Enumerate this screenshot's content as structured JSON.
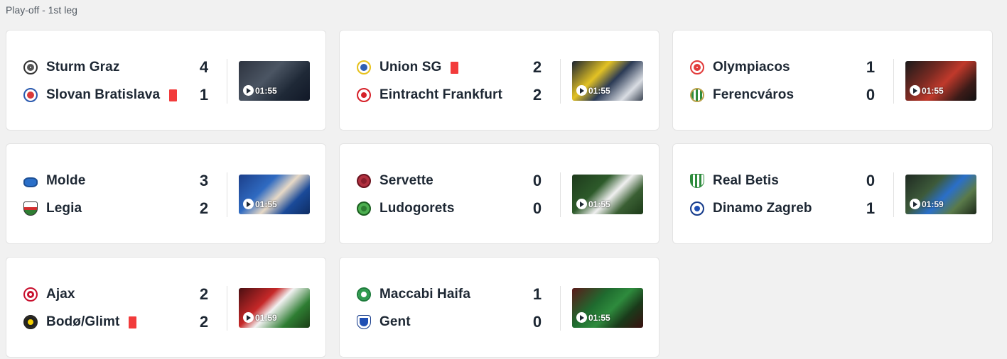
{
  "section_title": "Play-off - 1st leg",
  "matches": [
    {
      "home": {
        "name": "Sturm Graz",
        "score": "4",
        "crest": "sturm-graz-crest",
        "red_card": false
      },
      "away": {
        "name": "Slovan Bratislava",
        "score": "1",
        "crest": "slovan-bratislava-crest",
        "red_card": true
      },
      "video": {
        "duration": "01:55"
      }
    },
    {
      "home": {
        "name": "Union SG",
        "score": "2",
        "crest": "union-sg-crest",
        "red_card": true
      },
      "away": {
        "name": "Eintracht Frankfurt",
        "score": "2",
        "crest": "eintracht-frankfurt-crest",
        "red_card": false
      },
      "video": {
        "duration": "01:55"
      }
    },
    {
      "home": {
        "name": "Olympiacos",
        "score": "1",
        "crest": "olympiacos-crest",
        "red_card": false
      },
      "away": {
        "name": "Ferencváros",
        "score": "0",
        "crest": "ferencvaros-crest",
        "red_card": false
      },
      "video": {
        "duration": "01:55"
      }
    },
    {
      "home": {
        "name": "Molde",
        "score": "3",
        "crest": "molde-crest",
        "red_card": false
      },
      "away": {
        "name": "Legia",
        "score": "2",
        "crest": "legia-crest",
        "red_card": false
      },
      "video": {
        "duration": "01:55"
      }
    },
    {
      "home": {
        "name": "Servette",
        "score": "0",
        "crest": "servette-crest",
        "red_card": false
      },
      "away": {
        "name": "Ludogorets",
        "score": "0",
        "crest": "ludogorets-crest",
        "red_card": false
      },
      "video": {
        "duration": "01:55"
      }
    },
    {
      "home": {
        "name": "Real Betis",
        "score": "0",
        "crest": "real-betis-crest",
        "red_card": false
      },
      "away": {
        "name": "Dinamo Zagreb",
        "score": "1",
        "crest": "dinamo-zagreb-crest",
        "red_card": false
      },
      "video": {
        "duration": "01:59"
      }
    },
    {
      "home": {
        "name": "Ajax",
        "score": "2",
        "crest": "ajax-crest",
        "red_card": false
      },
      "away": {
        "name": "Bodø/Glimt",
        "score": "2",
        "crest": "bodo-glimt-crest",
        "red_card": true
      },
      "video": {
        "duration": "01:59"
      }
    },
    {
      "home": {
        "name": "Maccabi Haifa",
        "score": "1",
        "crest": "maccabi-haifa-crest",
        "red_card": false
      },
      "away": {
        "name": "Gent",
        "score": "0",
        "crest": "gent-crest",
        "red_card": false
      },
      "video": {
        "duration": "01:55"
      }
    }
  ],
  "colors": {
    "red_card": "#f23b3b",
    "text": "#1d2733",
    "card_bg": "#ffffff",
    "page_bg": "#f1f1f1"
  }
}
